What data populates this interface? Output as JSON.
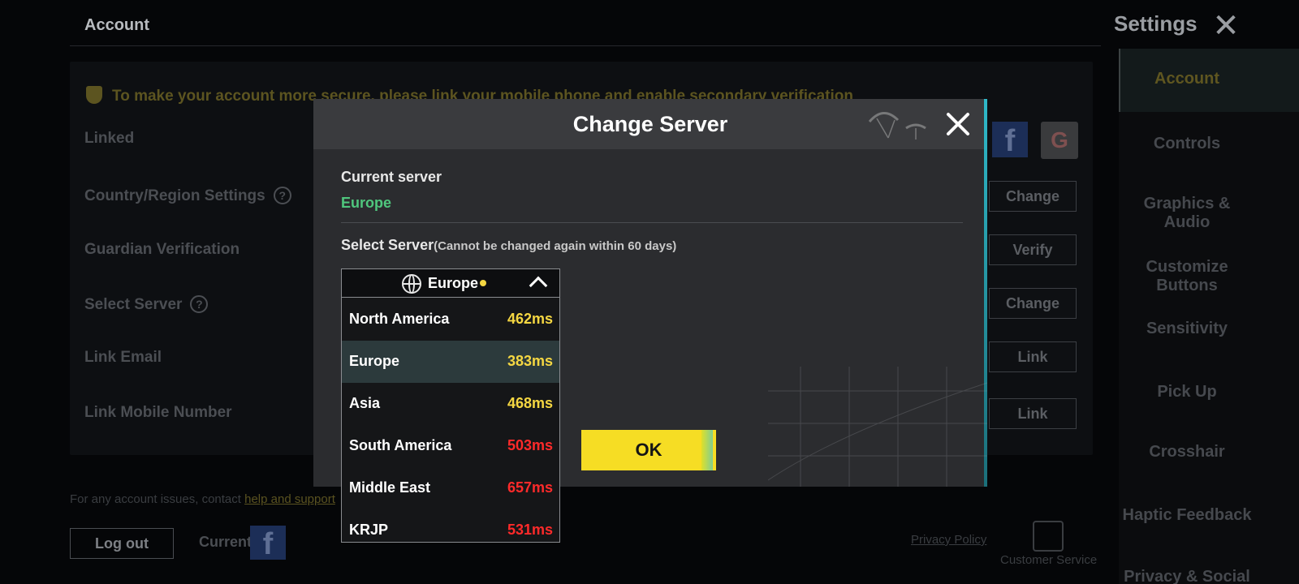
{
  "background": {
    "account_title": "Account",
    "settings_title": "Settings",
    "warning": "To make your account more secure, please link your mobile phone and enable secondary verification",
    "rows": [
      {
        "label": "Linked",
        "button": ""
      },
      {
        "label": "Country/Region Settings",
        "button": "Change"
      },
      {
        "label": "Guardian Verification",
        "button": "Verify"
      },
      {
        "label": "Select Server",
        "button": "Change"
      },
      {
        "label": "Link Email",
        "button": "Link"
      },
      {
        "label": "Link Mobile Number",
        "button": "Link"
      }
    ],
    "footer_note": "For any account issues, contact",
    "footer_link": "help and support",
    "logout_label": "Log out",
    "current_label": "Current",
    "privacy_label": "Privacy Policy",
    "customer_service_label": "Customer Service"
  },
  "nav": {
    "items": [
      "Account",
      "Controls",
      "Graphics & Audio",
      "Customize Buttons",
      "Sensitivity",
      "Pick Up",
      "Crosshair",
      "Haptic Feedback",
      "Privacy & Social"
    ],
    "active": "Account",
    "active_color": "#f6dd24"
  },
  "modal": {
    "title": "Change Server",
    "current_label": "Current server",
    "current_value": "Europe",
    "select_label": "Select Server",
    "select_note": "(Cannot be changed again within 60 days)",
    "ok_label": "OK"
  },
  "dropdown": {
    "selected": "Europe",
    "options": [
      {
        "name": "North America",
        "ping": "462ms",
        "color": "#f5d742"
      },
      {
        "name": "Europe",
        "ping": "383ms",
        "color": "#f5d742"
      },
      {
        "name": "Asia",
        "ping": "468ms",
        "color": "#f5d742"
      },
      {
        "name": "South America",
        "ping": "503ms",
        "color": "#ff2a2a"
      },
      {
        "name": "Middle East",
        "ping": "657ms",
        "color": "#ff2a2a"
      },
      {
        "name": "KRJP",
        "ping": "531ms",
        "color": "#ff2a2a"
      }
    ]
  },
  "colors": {
    "accent_yellow": "#f6dd24",
    "current_green": "#4fc67d",
    "ping_good": "#f5d742",
    "ping_bad": "#ff2a2a"
  }
}
